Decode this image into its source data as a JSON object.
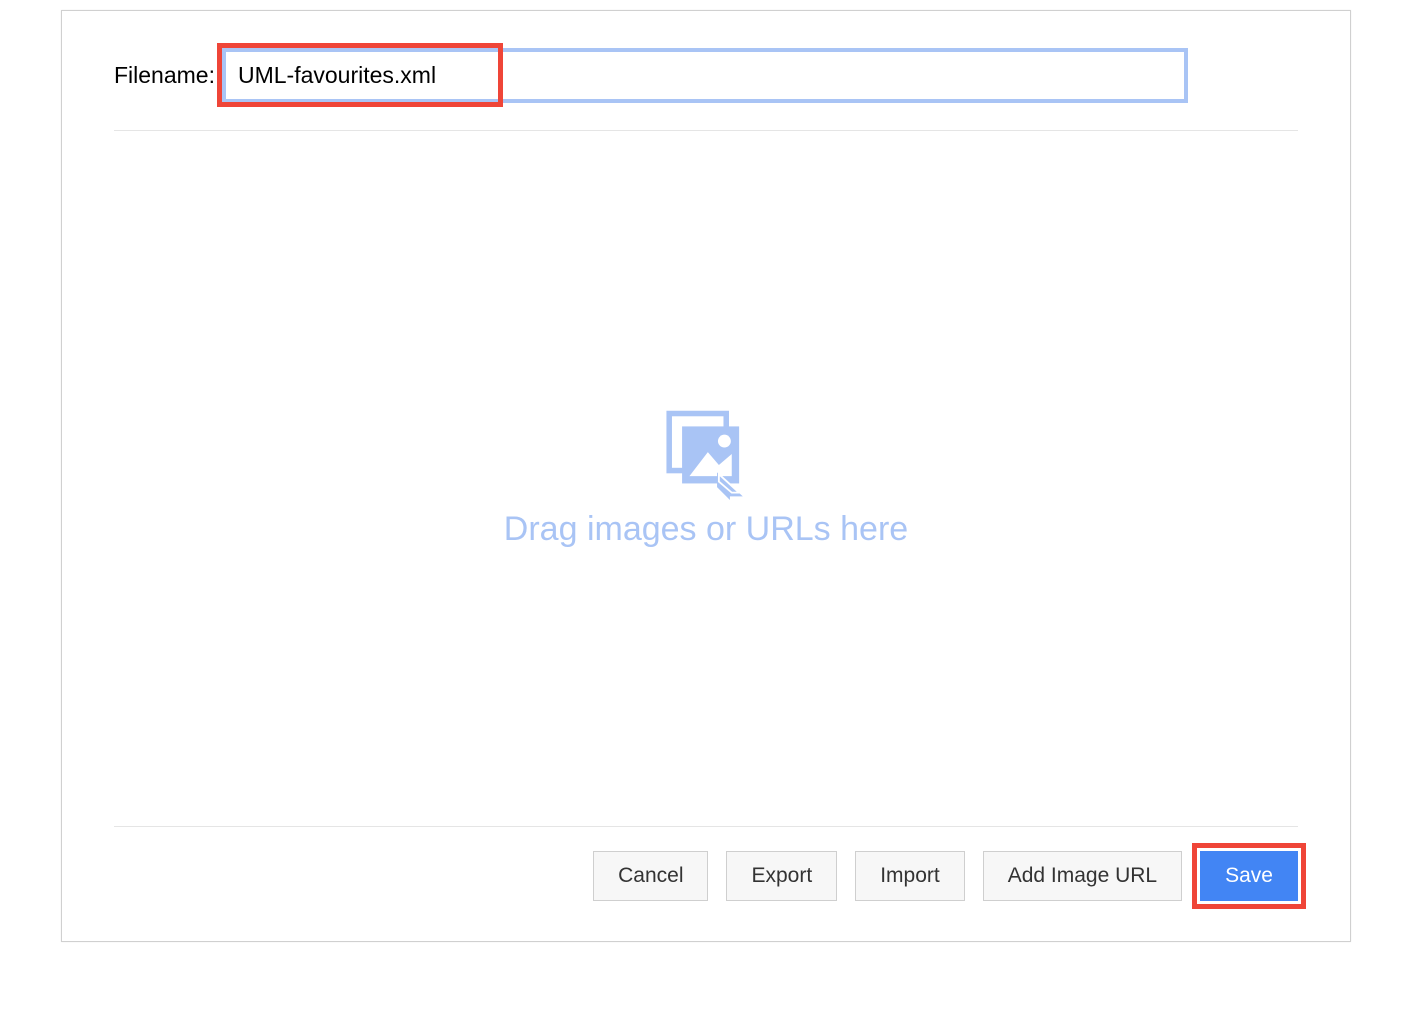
{
  "header": {
    "filename_label": "Filename:",
    "filename_value": "UML-favourites.xml"
  },
  "drop_area": {
    "text": "Drag images or URLs here",
    "icon_name": "image-drop-icon"
  },
  "footer": {
    "cancel_label": "Cancel",
    "export_label": "Export",
    "import_label": "Import",
    "add_image_url_label": "Add Image URL",
    "save_label": "Save"
  },
  "colors": {
    "accent": "#4285f4",
    "accent_light": "#a9c4f5",
    "highlight": "#ef4538"
  }
}
